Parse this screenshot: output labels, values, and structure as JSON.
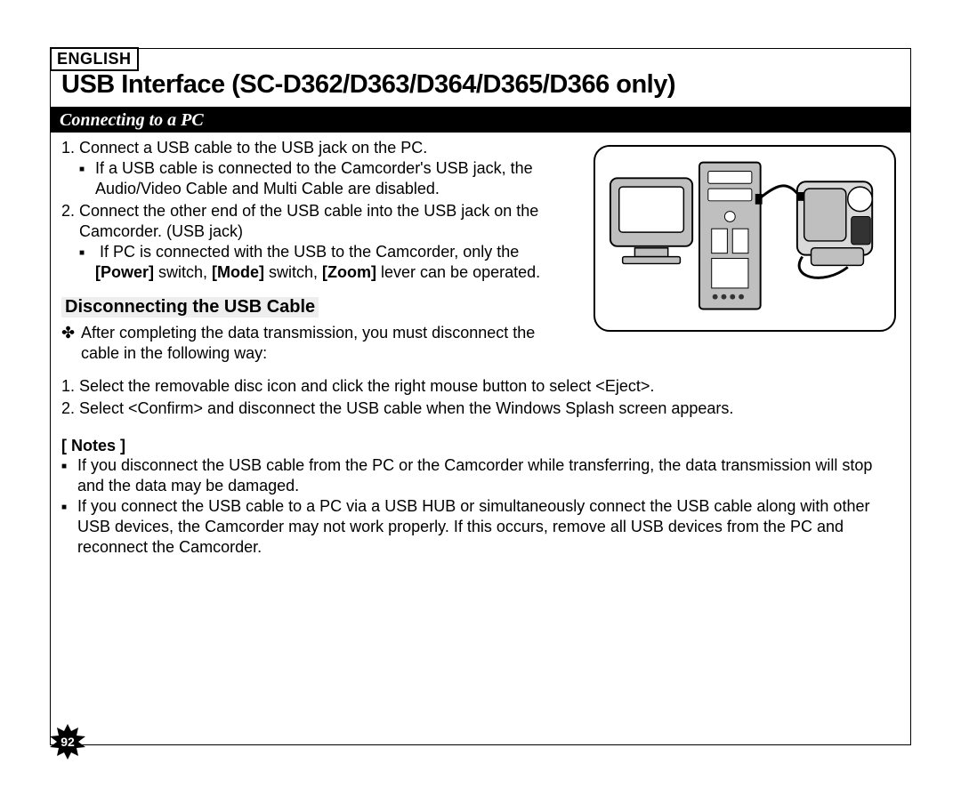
{
  "lang_tag": "ENGLISH",
  "title": "USB Interface (SC-D362/D363/D364/D365/D366 only)",
  "section_bar": "Connecting to a PC",
  "steps1": {
    "s1": "Connect a USB cable to the USB jack on the PC.",
    "s1_sub1": "If a USB cable is connected to the Camcorder's USB jack, the Audio/Video Cable and Multi Cable are disabled.",
    "s2": "Connect the other end of the USB cable into the USB jack on the Camcorder. (USB jack)",
    "s2_sub1_pre": "If PC is connected with the USB to the Camcorder, only the ",
    "s2_sub1_power": "[Power]",
    "s2_sub1_mid1": " switch, ",
    "s2_sub1_mode": "[Mode]",
    "s2_sub1_mid2": " switch, ",
    "s2_sub1_zoom": "[Zoom]",
    "s2_sub1_post": " lever can be operated."
  },
  "subheading": "Disconnecting the USB Cable",
  "cross_bullet": "After completing the data transmission, you must disconnect the cable in the following way:",
  "steps2": {
    "s1": "Select the removable disc icon and click the right mouse button to select <Eject>.",
    "s2": "Select <Confirm> and disconnect the USB cable when the Windows Splash screen appears."
  },
  "notes_label": "[ Notes ]",
  "notes": {
    "n1": "If you disconnect the USB cable from the PC or the Camcorder while transferring, the data transmission will stop and the data may be damaged.",
    "n2": "If you connect the USB cable to a PC via a USB HUB or simultaneously connect the USB cable along with other USB devices, the Camcorder may not work properly. If this occurs, remove all USB devices from the PC and reconnect the Camcorder."
  },
  "figure_alt": "Illustration: PC with monitor connected to camcorder via USB cable",
  "page_number": "92"
}
